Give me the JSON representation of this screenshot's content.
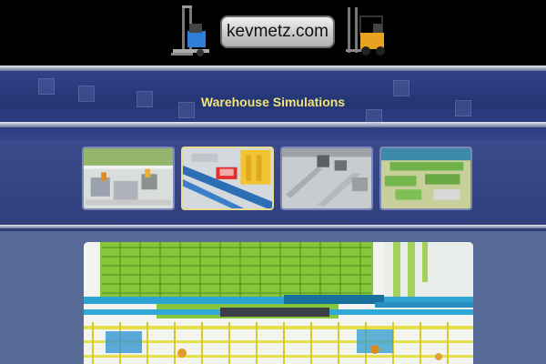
{
  "header": {
    "logo_text": "kevmetz.com",
    "left_icon": "blue-forklift-icon",
    "right_icon": "yellow-forklift-icon"
  },
  "page_title": "Warehouse Simulations",
  "thumbnails": [
    {
      "name": "thumbnail-1",
      "selected": false
    },
    {
      "name": "thumbnail-2",
      "selected": true
    },
    {
      "name": "thumbnail-3",
      "selected": false
    },
    {
      "name": "thumbnail-4",
      "selected": false
    }
  ],
  "colors": {
    "background": "#586a97",
    "title_band": "#2a3a7a",
    "title_text": "#f2e27a",
    "selected_border": "#e7da92"
  }
}
